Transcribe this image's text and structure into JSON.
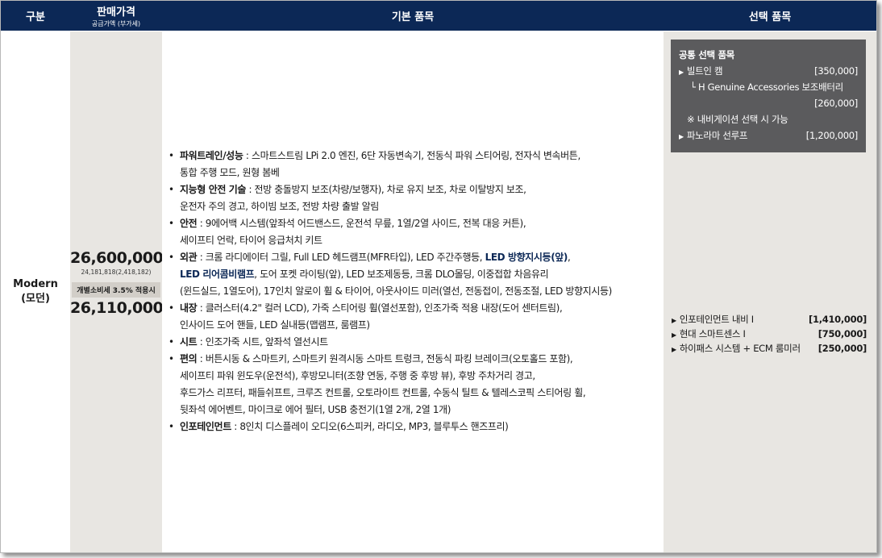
{
  "header": {
    "col_trim": "구분",
    "col_price": "판매가격",
    "col_price_sub": "공급가액 (부가세)",
    "col_basic": "기본 품목",
    "col_option": "선택 품목"
  },
  "trim": {
    "name_line1": "Modern",
    "name_line2": "(모던)"
  },
  "price": {
    "base": "26,600,000",
    "base_sub": "24,181,818(2,418,182)",
    "tax_label": "개별소비세 3.5% 적용시",
    "tax_price": "26,110,000"
  },
  "basic_items": [
    {
      "key": "파워트레인/성능",
      "text_line1": " : 스마트스트림 LPi 2.0 엔진, 6단 자동변속기, 전동식 파워 스티어링, 전자식 변속버튼,",
      "text_line2": "통합 주행 모드, 원형 봄베"
    },
    {
      "key": "지능형 안전 기술",
      "text_line1": " : 전방 충돌방지 보조(차량/보행자), 차로 유지 보조, 차로 이탈방지 보조,",
      "text_line2": "운전자 주의 경고, 하이빔 보조, 전방 차량 출발 알림"
    },
    {
      "key": "안전",
      "text_line1": " : 9에어백 시스템(앞좌석 어드밴스드, 운전석 무릎, 1열/2열 사이드, 전복 대응 커튼),",
      "text_line2": "세이프티 언락, 타이어 응급처치 키트"
    },
    {
      "key": "외관",
      "text_line1a": " : 크롬 라디에이터 그릴, Full LED 헤드램프(MFR타입), LED 주간주행등, ",
      "hl1": "LED 방향지시등(앞)",
      "text_line1b": ",",
      "hl2": "LED 리어콤비램프",
      "text_line2": ", 도어 포켓 라이팅(앞), LED 보조제동등, 크롬 DLO몰딩, 이중접합 차음유리",
      "text_line3": "(윈드실드, 1열도어), 17인치 알로이 휠 & 타이어, 아웃사이드 미러(열선, 전동접이, 전동조절, LED 방향지시등)"
    },
    {
      "key": "내장",
      "text_line1": " : 클러스터(4.2\" 컬러 LCD), 가죽 스티어링 휠(열선포함), 인조가죽 적용 내장(도어 센터트림),",
      "text_line2": "인사이드 도어 핸들, LED 실내등(맵램프, 룸램프)"
    },
    {
      "key": "시트",
      "text_line1": " : 인조가죽 시트, 앞좌석 열선시트"
    },
    {
      "key": "편의",
      "text_line1": " : 버튼시동 & 스마트키, 스마트키 원격시동 스마트 트렁크, 전동식 파킹 브레이크(오토홀드 포함),",
      "text_line2": "세이프티 파워 윈도우(운전석), 후방모니터(조향 연동, 주행 중 후방 뷰), 후방 주차거리 경고,",
      "text_line3": "후드가스 리프터, 패들쉬프트, 크루즈 컨트롤, 오토라이트 컨트롤, 수동식 틸트 & 텔레스코픽 스티어링 휠,",
      "text_line4": "뒷좌석 에어벤트, 마이크로 에어 필터, USB 충전기(1열 2개, 2열 1개)"
    },
    {
      "key": "인포테인먼트",
      "text_line1": " : 8인치 디스플레이 오디오(6스피커, 라디오, MP3, 블루투스 핸즈프리)"
    }
  ],
  "common_options": {
    "title": "공통 선택 품목",
    "builtin_cam": "빌트인 캠",
    "builtin_cam_price": "[350,000]",
    "aux_battery": "└ H Genuine Accessories 보조배터리",
    "aux_battery_price": "[260,000]",
    "nav_note": "※ 내비게이션 선택 시 가능",
    "panorama": "파노라마 선루프",
    "panorama_price": "[1,200,000]"
  },
  "options": [
    {
      "label": "인포테인먼트 내비 I",
      "price": "[1,410,000]"
    },
    {
      "label": "현대 스마트센스 I",
      "price": "[750,000]"
    },
    {
      "label": "하이패스 시스템 + ECM 룸미러",
      "price": "[250,000]"
    }
  ],
  "colors": {
    "header_bg": "#0c2856",
    "panel_bg": "#e8e6e2",
    "common_box_bg": "#5b5b5d"
  },
  "icons": {
    "bullet": "triangle-right-icon"
  }
}
